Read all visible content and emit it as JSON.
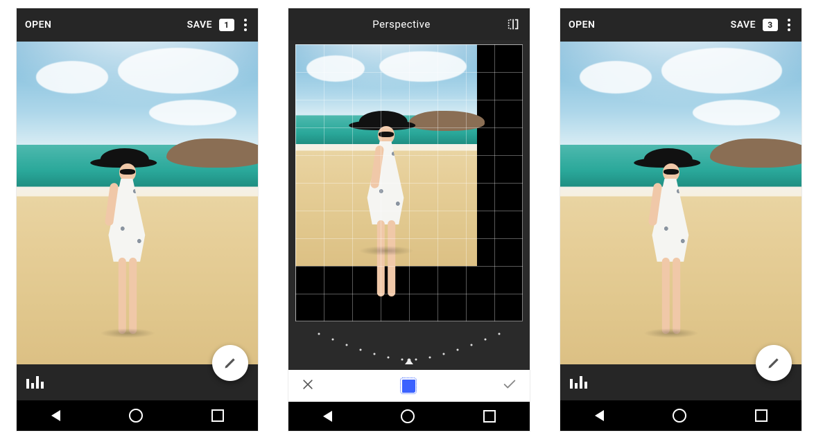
{
  "phones": {
    "left": {
      "open_label": "OPEN",
      "save_label": "SAVE",
      "history_count": "1"
    },
    "middle": {
      "title": "Perspective"
    },
    "right": {
      "open_label": "OPEN",
      "save_label": "SAVE",
      "history_count": "3"
    }
  },
  "icons": {
    "overflow": "overflow-menu",
    "flip": "flip-horizontal",
    "histogram": "histogram",
    "edit": "edit-pencil",
    "cancel": "cancel-x",
    "fill_mode": "fill-smart",
    "confirm": "confirm-check",
    "nav_back": "nav-back",
    "nav_home": "nav-home",
    "nav_recent": "nav-recent"
  }
}
